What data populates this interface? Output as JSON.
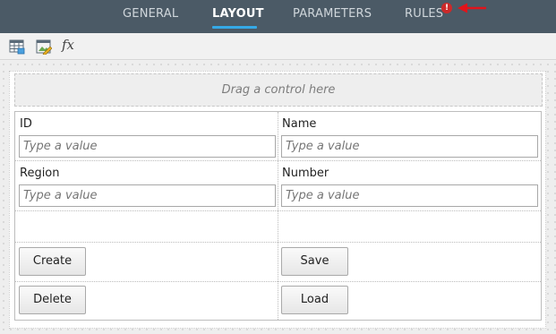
{
  "tabs": [
    {
      "label": "GENERAL",
      "active": false
    },
    {
      "label": "LAYOUT",
      "active": true
    },
    {
      "label": "PARAMETERS",
      "active": false
    },
    {
      "label": "RULES",
      "active": false
    }
  ],
  "rules_alert_glyph": "!",
  "toolbar": {
    "icons": [
      "table-layout-icon",
      "edit-image-icon",
      "fx-icon"
    ],
    "fx_label": "fx"
  },
  "dropzone": {
    "text": "Drag a control here"
  },
  "form": {
    "fields": [
      {
        "label": "ID",
        "placeholder": "Type a value"
      },
      {
        "label": "Name",
        "placeholder": "Type a value"
      },
      {
        "label": "Region",
        "placeholder": "Type a value"
      },
      {
        "label": "Number",
        "placeholder": "Type a value"
      }
    ],
    "buttons": [
      {
        "label": "Create"
      },
      {
        "label": "Save"
      },
      {
        "label": "Delete"
      },
      {
        "label": "Load"
      }
    ]
  },
  "colors": {
    "tabbar": "#4b5a66",
    "active_underline": "#35a9e6",
    "alert": "#cc2a2a",
    "annotation_arrow": "#e0141b"
  }
}
